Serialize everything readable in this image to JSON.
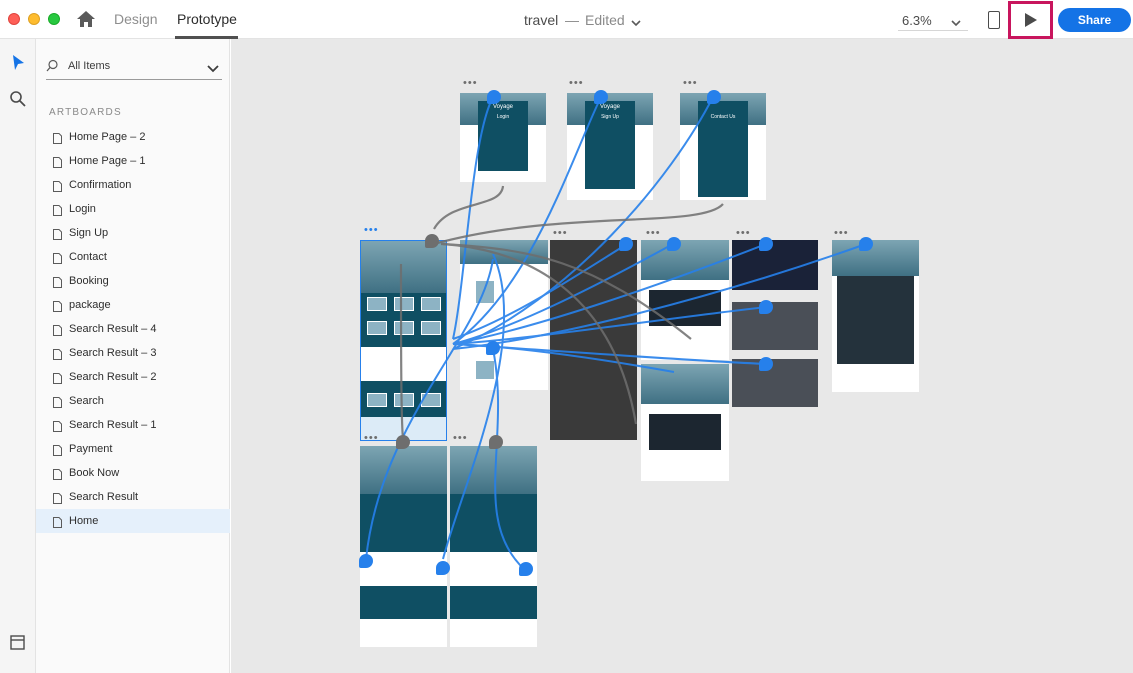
{
  "titlebar": {
    "home_icon": "home-icon",
    "tabs": [
      {
        "label": "Design",
        "active": false
      },
      {
        "label": "Prototype",
        "active": true
      }
    ],
    "document": {
      "name": "travel",
      "separator": "—",
      "status": "Edited"
    },
    "zoom": "6.3%",
    "device_preview_icon": "mobile-device-icon",
    "play_icon": "play-icon",
    "share_label": "Share",
    "colors": {
      "accent": "#1473e6",
      "highlight_frame": "#c8155d"
    }
  },
  "toolrail": {
    "tools": [
      "select-arrow-icon",
      "zoom-search-icon"
    ],
    "bottom_tool": "layers-panel-icon"
  },
  "panel": {
    "filter_label": "All Items",
    "section_title": "ARTBOARDS",
    "artboards": [
      {
        "label": "Home Page – 2"
      },
      {
        "label": "Home Page – 1"
      },
      {
        "label": "Confirmation"
      },
      {
        "label": "Login"
      },
      {
        "label": "Sign Up"
      },
      {
        "label": "Contact"
      },
      {
        "label": "Booking"
      },
      {
        "label": "package"
      },
      {
        "label": "Search Result – 4"
      },
      {
        "label": "Search Result – 3"
      },
      {
        "label": "Search Result – 2"
      },
      {
        "label": "Search"
      },
      {
        "label": "Search Result – 1"
      },
      {
        "label": "Payment"
      },
      {
        "label": "Book Now"
      },
      {
        "label": "Search Result"
      },
      {
        "label": "Home",
        "selected": true
      }
    ]
  },
  "canvas": {
    "artboard_mini_text": {
      "brand": "Voyage",
      "login": "Login",
      "signup": "Sign Up",
      "contact": "Contact Us"
    },
    "colors": {
      "wire": "#2680eb",
      "wire_alt": "#6e6e6e",
      "artboard_bg": "#0f4f63"
    }
  }
}
